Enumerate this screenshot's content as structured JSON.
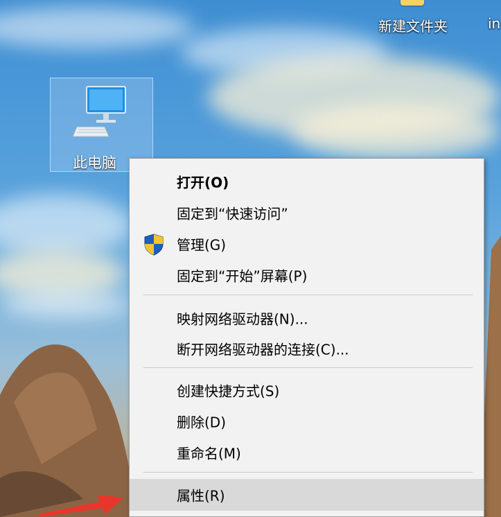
{
  "desktop": {
    "top_icons": [
      {
        "label": "新建文件夹"
      },
      {
        "label": "in"
      }
    ],
    "selected_icon": {
      "label": "此电脑",
      "icon": "this-pc-monitor-icon"
    }
  },
  "context_menu": {
    "items": [
      {
        "label": "打开(O)"
      },
      {
        "label": "固定到“快速访问”"
      },
      {
        "label": "管理(G)",
        "icon": "uac-shield-icon"
      },
      {
        "label": "固定到“开始”屏幕(P)"
      },
      {
        "label": "映射网络驱动器(N)..."
      },
      {
        "label": "断开网络驱动器的连接(C)..."
      },
      {
        "label": "创建快捷方式(S)"
      },
      {
        "label": "删除(D)"
      },
      {
        "label": "重命名(M)"
      },
      {
        "label": "属性(R)"
      }
    ],
    "hovered_item": "属性(R)"
  },
  "colors": {
    "menu_background": "#f2f2f2",
    "menu_hover": "#d9d9d9",
    "annotation_arrow": "#e8362a"
  }
}
